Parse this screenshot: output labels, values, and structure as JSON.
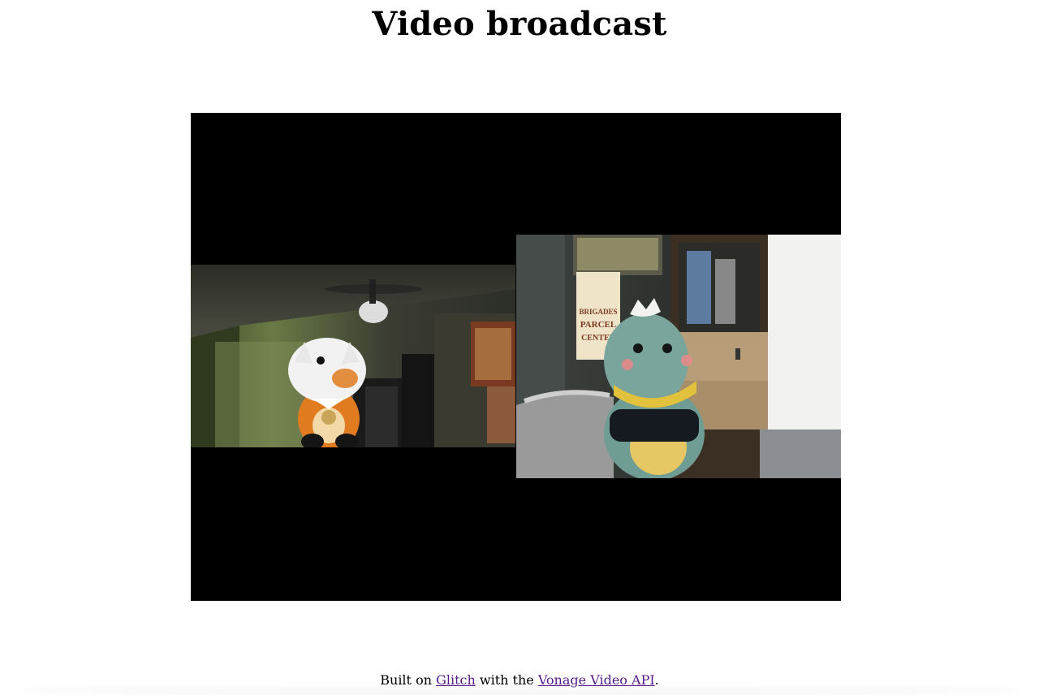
{
  "page": {
    "title": "Video broadcast"
  },
  "video": {
    "feeds": [
      {
        "name": "publisher-feed-left",
        "scene": "orange fox plush toy in a room with ceiling fan"
      },
      {
        "name": "publisher-feed-right",
        "scene": "green dinosaur plush toy in front of shelves",
        "poster_text": [
          "BRIGADES",
          "PARCEL",
          "CENTER"
        ]
      }
    ]
  },
  "footer": {
    "prefix": "Built on ",
    "link1": "Glitch",
    "middle": " with the ",
    "link2": "Vonage Video API",
    "suffix": "."
  },
  "colors": {
    "link": "#551a8b",
    "stage": "#000000"
  }
}
